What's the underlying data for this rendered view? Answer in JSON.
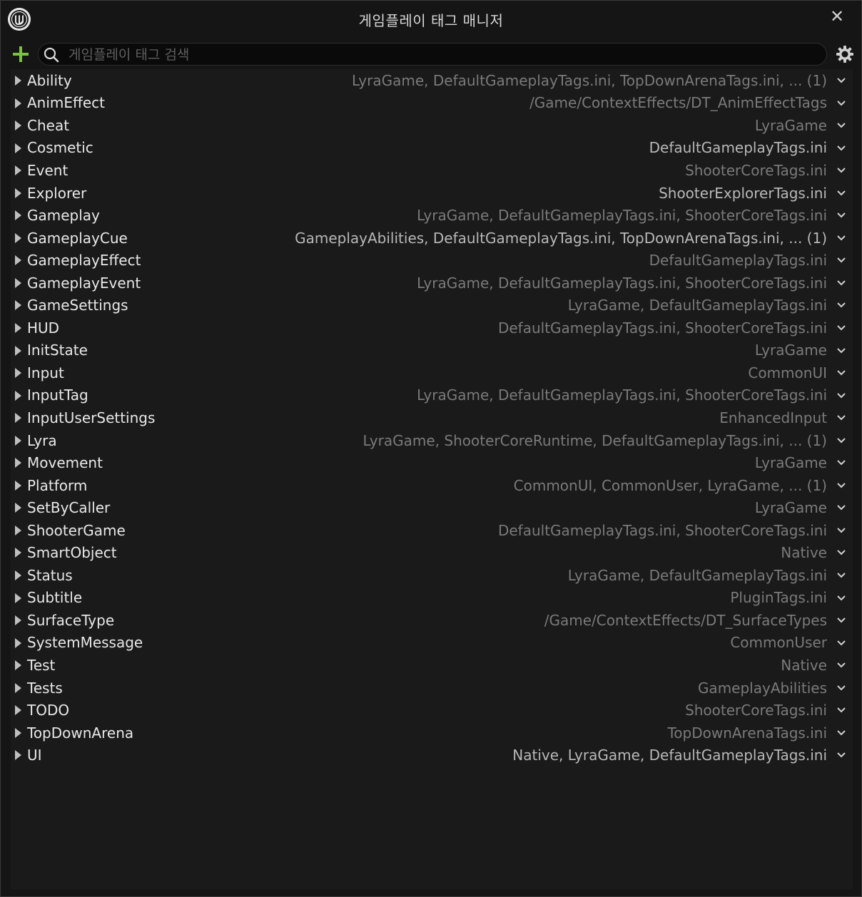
{
  "window": {
    "title": "게임플레이 태그 매니저"
  },
  "search": {
    "placeholder": "게임플레이 태그 검색"
  },
  "tags": [
    {
      "name": "Ability",
      "source": "LyraGame, DefaultGameplayTags.ini, TopDownArenaTags.ini, ... (1)",
      "tone": "dim"
    },
    {
      "name": "AnimEffect",
      "source": "/Game/ContextEffects/DT_AnimEffectTags",
      "tone": "dim"
    },
    {
      "name": "Cheat",
      "source": "LyraGame",
      "tone": "dim"
    },
    {
      "name": "Cosmetic",
      "source": "DefaultGameplayTags.ini",
      "tone": "bright"
    },
    {
      "name": "Event",
      "source": "ShooterCoreTags.ini",
      "tone": "dim"
    },
    {
      "name": "Explorer",
      "source": "ShooterExplorerTags.ini",
      "tone": "bright"
    },
    {
      "name": "Gameplay",
      "source": "LyraGame, DefaultGameplayTags.ini, ShooterCoreTags.ini",
      "tone": "dim"
    },
    {
      "name": "GameplayCue",
      "source": "GameplayAbilities, DefaultGameplayTags.ini, TopDownArenaTags.ini, ... (1)",
      "tone": "bright"
    },
    {
      "name": "GameplayEffect",
      "source": "DefaultGameplayTags.ini",
      "tone": "dim"
    },
    {
      "name": "GameplayEvent",
      "source": "LyraGame, DefaultGameplayTags.ini, ShooterCoreTags.ini",
      "tone": "dim"
    },
    {
      "name": "GameSettings",
      "source": "LyraGame, DefaultGameplayTags.ini",
      "tone": "dim"
    },
    {
      "name": "HUD",
      "source": "DefaultGameplayTags.ini, ShooterCoreTags.ini",
      "tone": "dim"
    },
    {
      "name": "InitState",
      "source": "LyraGame",
      "tone": "dim"
    },
    {
      "name": "Input",
      "source": "CommonUI",
      "tone": "dim"
    },
    {
      "name": "InputTag",
      "source": "LyraGame, DefaultGameplayTags.ini, ShooterCoreTags.ini",
      "tone": "dim"
    },
    {
      "name": "InputUserSettings",
      "source": "EnhancedInput",
      "tone": "dim"
    },
    {
      "name": "Lyra",
      "source": "LyraGame, ShooterCoreRuntime, DefaultGameplayTags.ini, ... (1)",
      "tone": "dim"
    },
    {
      "name": "Movement",
      "source": "LyraGame",
      "tone": "dim"
    },
    {
      "name": "Platform",
      "source": "CommonUI, CommonUser, LyraGame, ... (1)",
      "tone": "dim"
    },
    {
      "name": "SetByCaller",
      "source": "LyraGame",
      "tone": "dim"
    },
    {
      "name": "ShooterGame",
      "source": "DefaultGameplayTags.ini, ShooterCoreTags.ini",
      "tone": "dim"
    },
    {
      "name": "SmartObject",
      "source": "Native",
      "tone": "dim"
    },
    {
      "name": "Status",
      "source": "LyraGame, DefaultGameplayTags.ini",
      "tone": "dim"
    },
    {
      "name": "Subtitle",
      "source": "PluginTags.ini",
      "tone": "dim"
    },
    {
      "name": "SurfaceType",
      "source": "/Game/ContextEffects/DT_SurfaceTypes",
      "tone": "dim"
    },
    {
      "name": "SystemMessage",
      "source": "CommonUser",
      "tone": "dim"
    },
    {
      "name": "Test",
      "source": "Native",
      "tone": "dim"
    },
    {
      "name": "Tests",
      "source": "GameplayAbilities",
      "tone": "dim"
    },
    {
      "name": "TODO",
      "source": "ShooterCoreTags.ini",
      "tone": "dim"
    },
    {
      "name": "TopDownArena",
      "source": "TopDownArenaTags.ini",
      "tone": "dim"
    },
    {
      "name": "UI",
      "source": "Native, LyraGame, DefaultGameplayTags.ini",
      "tone": "bright"
    }
  ],
  "colors": {
    "accent_add": "#7bc142",
    "background": "#1a1a1a"
  },
  "icons": {
    "add": "plus-icon",
    "search": "search-icon",
    "settings": "gear-icon",
    "close": "close-icon",
    "expand": "triangle-right-icon",
    "menu": "chevron-down-icon",
    "logo": "unreal-logo-icon"
  }
}
